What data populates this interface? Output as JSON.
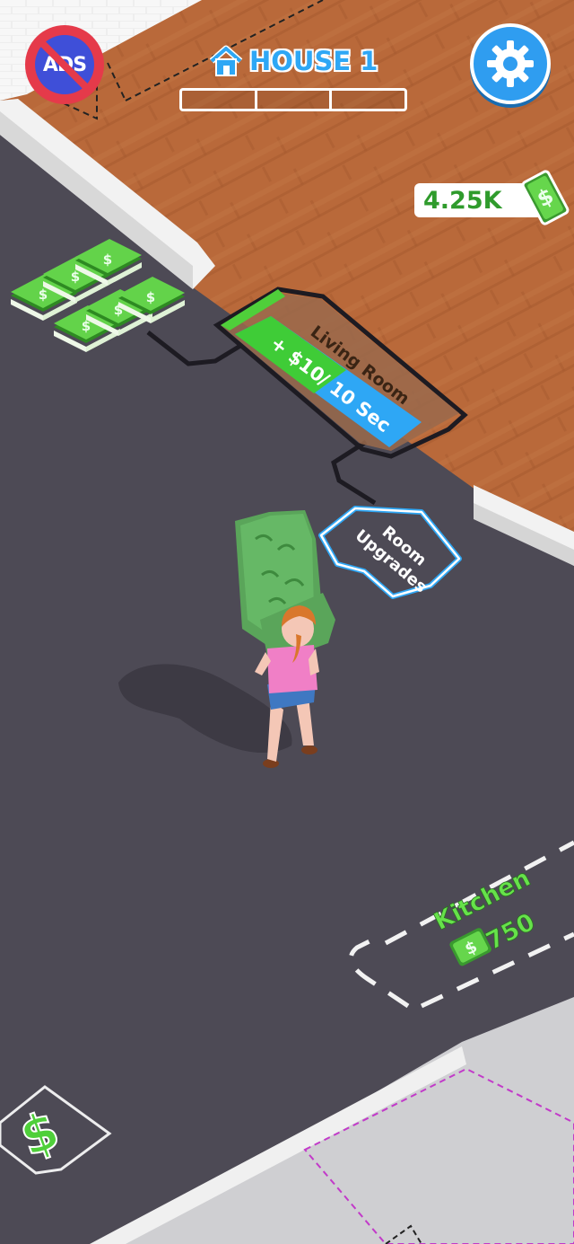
{
  "hud": {
    "no_ads_label": "ADS",
    "house_title": "HOUSE 1",
    "house_progress_segments": 3,
    "house_progress_filled": 0,
    "money": "4.25K"
  },
  "world": {
    "living_room_label": "Living Room",
    "income_label": "+ $10",
    "interval_label": "/ 10 Sec",
    "room_upgrades_line1": "Room",
    "room_upgrades_line2": "Upgrades",
    "kitchen_label": "Kitchen",
    "kitchen_cost": "750"
  },
  "icons": [
    "no-ads-icon",
    "house-icon",
    "gear-icon",
    "cash-icon",
    "dollar-icon"
  ],
  "colors": {
    "floor_dark": "#4d4a55",
    "wood_floor": "#b86d3e",
    "accent_green": "#4fcf3a",
    "accent_blue": "#2ea7f5",
    "ads_red": "#e53a4a"
  }
}
